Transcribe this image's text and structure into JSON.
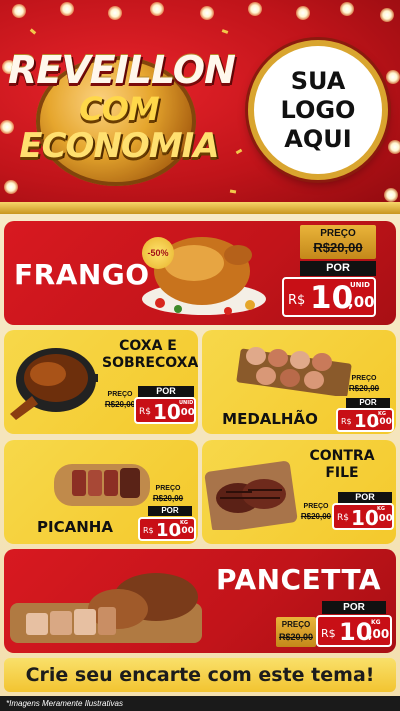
{
  "header": {
    "title_line1": "REVEILLON",
    "title_line2": "COM",
    "title_line3": "ECONOMIA",
    "logo_line1": "SUA",
    "logo_line2": "LOGO",
    "logo_line3": "AQUI"
  },
  "products": {
    "frango": {
      "name": "FRANGO",
      "discount": "-50%",
      "preco_label": "PREÇO",
      "old_price": "R$20,00",
      "por_label": "POR",
      "currency": "R$",
      "price_int": "10",
      "price_cents": ",00",
      "unit": "UNID"
    },
    "coxa": {
      "name_line1": "COXA E",
      "name_line2": "SOBRECOXA",
      "preco_label": "PREÇO",
      "old_price": "R$20,00",
      "por_label": "POR",
      "currency": "R$",
      "price_int": "10",
      "price_cents": ",00",
      "unit": "UNID"
    },
    "medalhao": {
      "name": "MEDALHÃO",
      "preco_label": "PREÇO",
      "old_price": "R$20,00",
      "por_label": "POR",
      "currency": "R$",
      "price_int": "10",
      "price_cents": ",00",
      "unit": "KG"
    },
    "picanha": {
      "name": "PICANHA",
      "preco_label": "PREÇO",
      "old_price": "R$20,00",
      "por_label": "POR",
      "currency": "R$",
      "price_int": "10",
      "price_cents": ",00",
      "unit": "KG"
    },
    "contra_file": {
      "name_line1": "CONTRA",
      "name_line2": "FILE",
      "preco_label": "PREÇO",
      "old_price": "R$20,00",
      "por_label": "POR",
      "currency": "R$",
      "price_int": "10",
      "price_cents": ",00",
      "unit": "KG"
    },
    "pancetta": {
      "name": "PANCETTA",
      "preco_label": "PREÇO",
      "old_price": "R$20,00",
      "por_label": "POR",
      "currency": "R$",
      "price_int": "10",
      "price_cents": ",00",
      "unit": "KG"
    }
  },
  "banner": {
    "text": "Crie seu encarte com este tema!"
  },
  "footer": {
    "note": "*Imagens Meramente Ilustrativas"
  },
  "colors": {
    "red": "#c80f16",
    "yellow": "#f4c92c",
    "gold": "#d9a52f"
  }
}
